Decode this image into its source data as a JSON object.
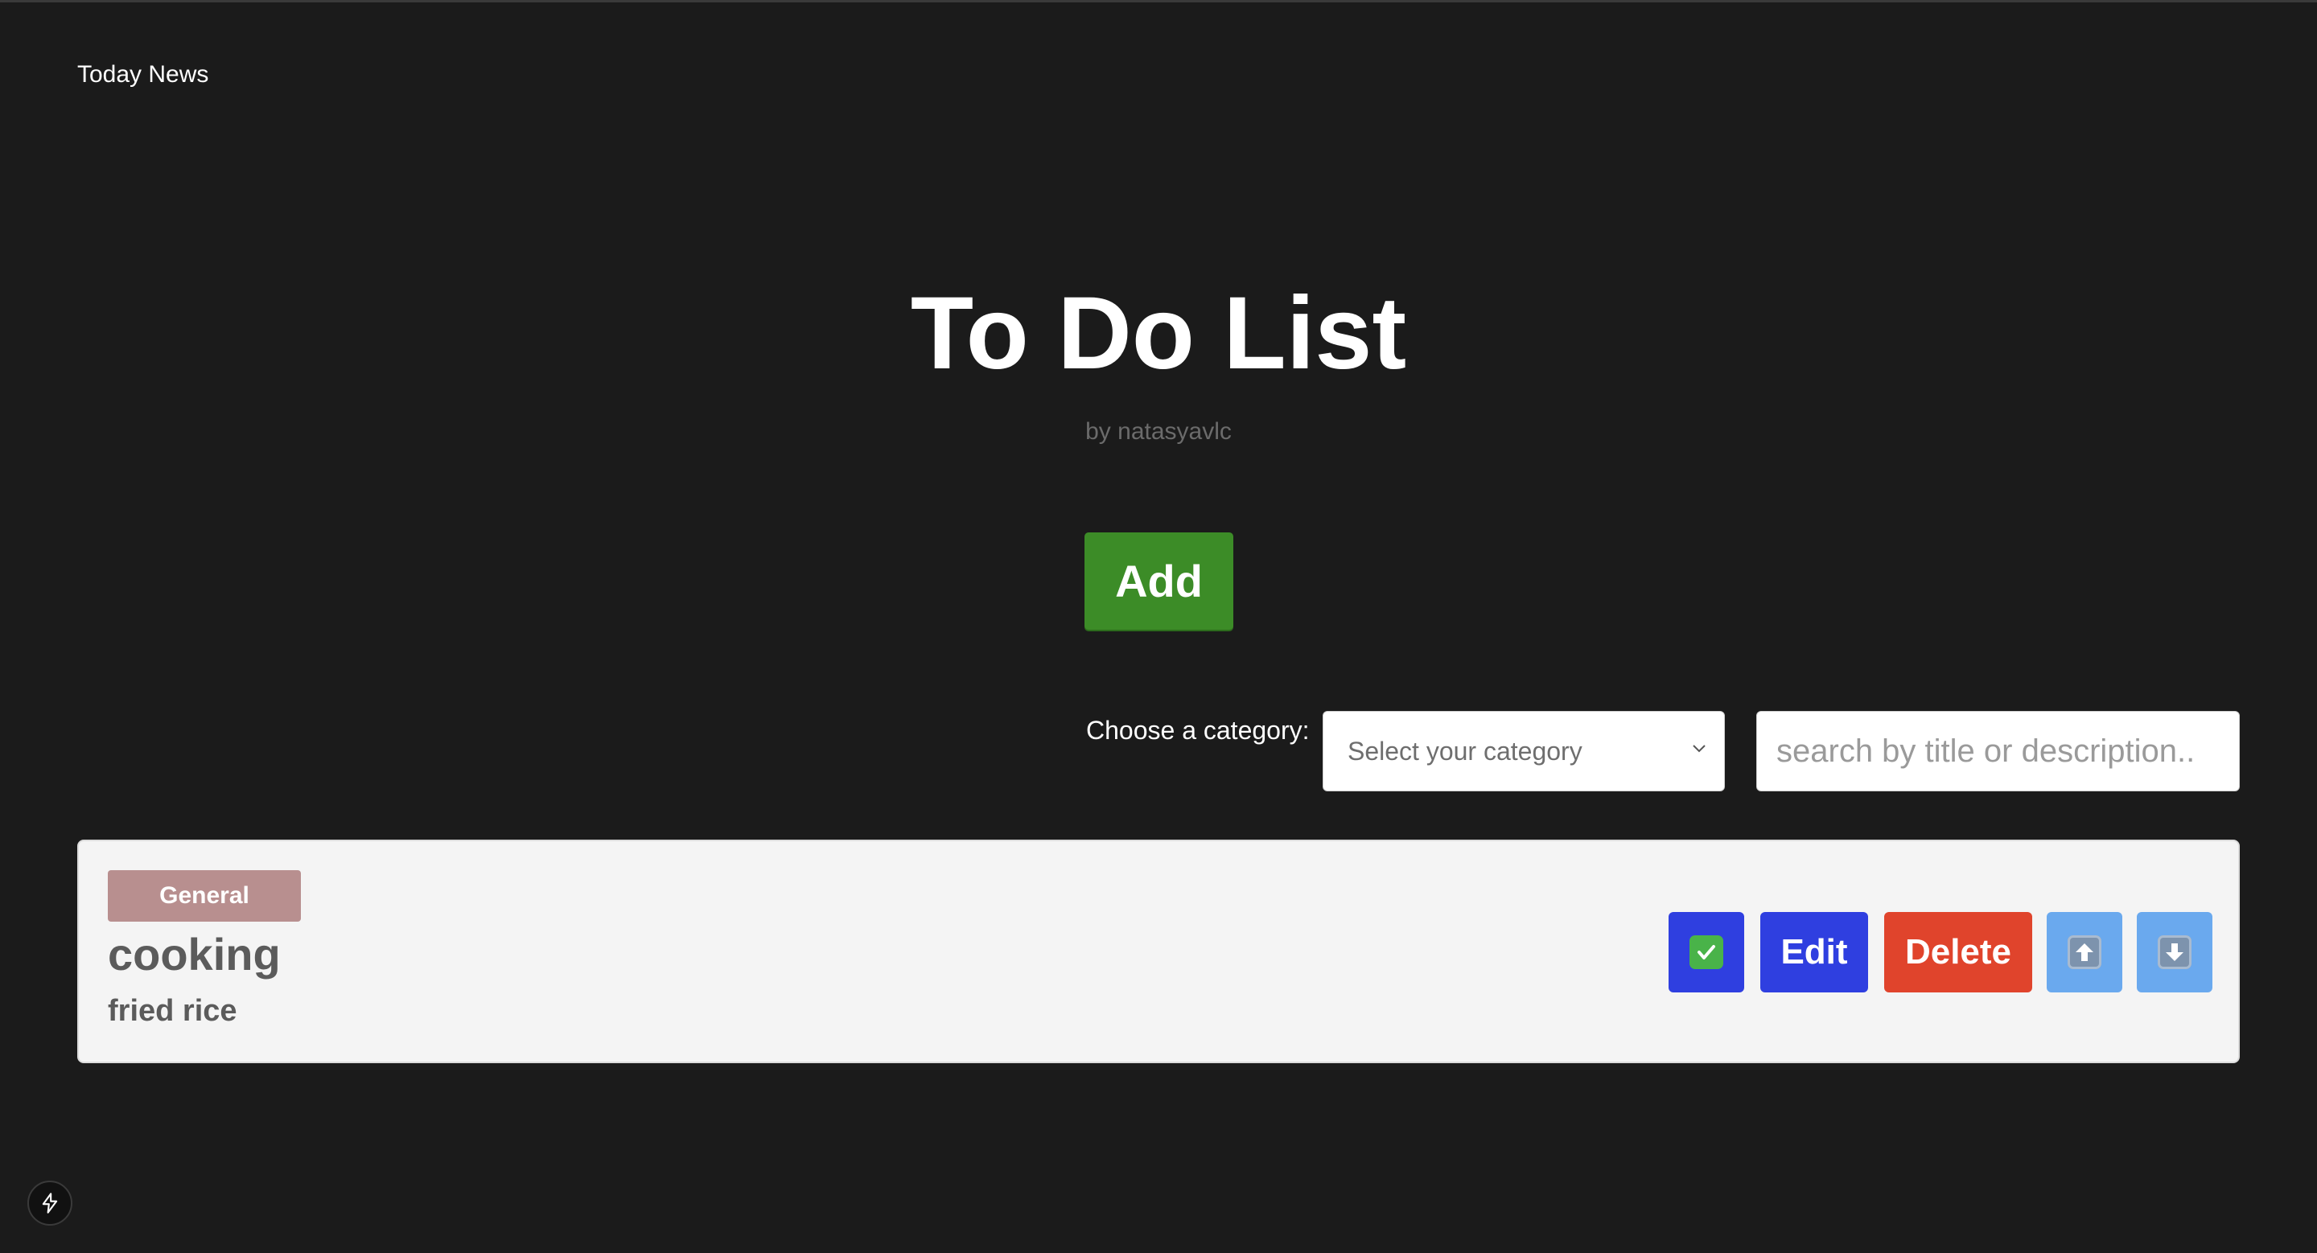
{
  "nav": {
    "link_label": "Today News"
  },
  "header": {
    "title": "To Do List",
    "byline": "by natasyavlc"
  },
  "actions": {
    "add_label": "Add"
  },
  "filter": {
    "category_label": "Choose a category:",
    "category_selected": "Select your category",
    "search_placeholder": "search by title or description.."
  },
  "tasks": [
    {
      "category": "General",
      "title": "cooking",
      "description": "fried rice",
      "buttons": {
        "done_icon": "check-mark-emoji",
        "edit_label": "Edit",
        "delete_label": "Delete",
        "up_icon": "up-arrow-emoji",
        "down_icon": "down-arrow-emoji"
      }
    }
  ],
  "colors": {
    "background": "#1b1b1b",
    "add_button": "#3c8c27",
    "primary_button": "#2f3fe0",
    "delete_button": "#e0442c",
    "move_button": "#6aa9ee",
    "category_badge": "#b88f8f",
    "card_background": "#f4f4f4"
  },
  "devtools": {
    "icon": "lightning-bolt-icon"
  }
}
